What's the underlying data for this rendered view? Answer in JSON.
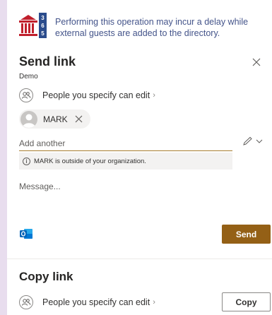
{
  "banner": {
    "text": "Performing this operation may incur a delay while external guests are added to the directory.",
    "logo_digits": [
      "3",
      "6",
      "5"
    ],
    "accent_color": "#c01f2c",
    "text_color": "#44548a"
  },
  "send_link": {
    "title": "Send link",
    "subtitle": "Demo",
    "permission": "People you specify can edit",
    "recipient": {
      "name": "MARK"
    },
    "add_placeholder": "Add another",
    "warning": "MARK is outside of your organization.",
    "message_placeholder": "Message...",
    "send_label": "Send",
    "send_color": "#946016"
  },
  "copy_link": {
    "title": "Copy link",
    "permission": "People you specify can edit",
    "copy_label": "Copy"
  },
  "icons": {
    "close": "close-icon",
    "people": "people-icon",
    "chevron": "chevron-right-icon",
    "pencil": "pencil-icon",
    "dropdown": "chevron-down-icon",
    "info": "info-icon",
    "outlook": "outlook-icon",
    "avatar": "avatar-icon",
    "remove": "remove-icon"
  }
}
